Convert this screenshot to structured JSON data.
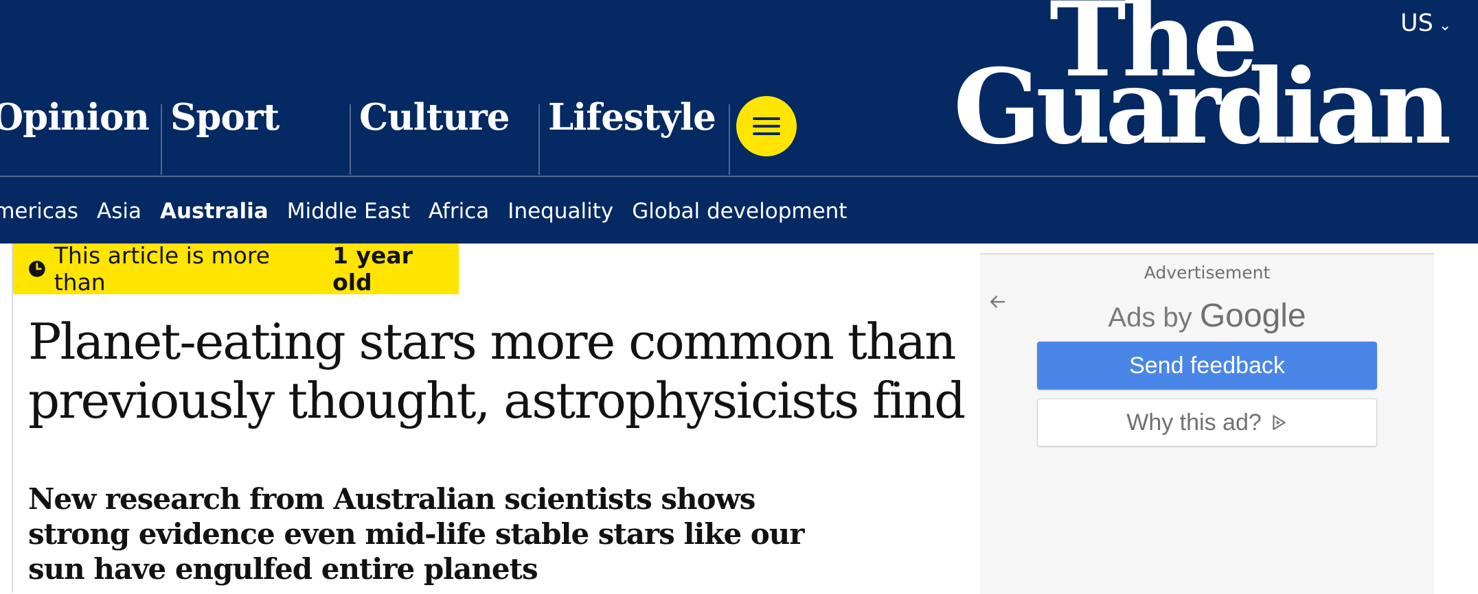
{
  "header": {
    "edition": "US",
    "logo": {
      "line1": "The",
      "line2": "Guardian"
    },
    "pillars": [
      "Opinion",
      "Sport",
      "Culture",
      "Lifestyle"
    ],
    "subnav": [
      {
        "label": "Americas",
        "active": false
      },
      {
        "label": "Asia",
        "active": false
      },
      {
        "label": "Australia",
        "active": true
      },
      {
        "label": "Middle East",
        "active": false
      },
      {
        "label": "Africa",
        "active": false
      },
      {
        "label": "Inequality",
        "active": false
      },
      {
        "label": "Global development",
        "active": false
      }
    ]
  },
  "article": {
    "age_prefix": "This article is more than",
    "age_value": "1 year old",
    "headline": "Planet-eating stars more common than previously thought, astrophysicists find",
    "standfirst": "New research from Australian scientists shows strong evidence even mid-life stable stars like our sun have engulfed entire planets"
  },
  "ad": {
    "label": "Advertisement",
    "ads_by": "Ads by",
    "google": "Google",
    "send_feedback": "Send feedback",
    "why_this_ad": "Why this ad?"
  },
  "colors": {
    "brand_navy": "#052962",
    "accent_yellow": "#ffe500",
    "ad_button_blue": "#4a86e8"
  },
  "icons": [
    "chevron-down-icon",
    "menu-icon",
    "clock-icon",
    "back-arrow-icon",
    "adchoices-icon"
  ]
}
